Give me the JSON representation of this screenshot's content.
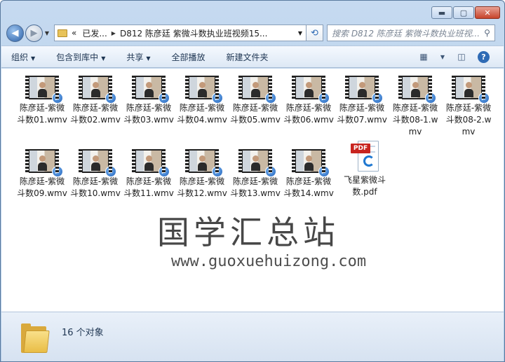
{
  "window": {
    "caption": {
      "minimize": "▬",
      "maximize": "▢",
      "close": "✕"
    }
  },
  "nav": {
    "back_icon": "arrow-left-icon",
    "forward_icon": "arrow-right-icon",
    "breadcrumb_prefix": "«",
    "breadcrumb_1": "已发...",
    "breadcrumb_2": "D812 陈彦廷 紫微斗数执业班视频15...",
    "search_placeholder": "搜索 D812 陈彦廷 紫微斗数执业班视..."
  },
  "toolbar": {
    "organize": "组织",
    "include_library": "包含到库中",
    "share": "共享",
    "play_all": "全部播放",
    "new_folder": "新建文件夹"
  },
  "files": [
    {
      "name": "陈彦廷-紫微斗数01.wmv",
      "type": "video"
    },
    {
      "name": "陈彦廷-紫微斗数02.wmv",
      "type": "video"
    },
    {
      "name": "陈彦廷-紫微斗数03.wmv",
      "type": "video"
    },
    {
      "name": "陈彦廷-紫微斗数04.wmv",
      "type": "video"
    },
    {
      "name": "陈彦廷-紫微斗数05.wmv",
      "type": "video"
    },
    {
      "name": "陈彦廷-紫微斗数06.wmv",
      "type": "video"
    },
    {
      "name": "陈彦廷-紫微斗数07.wmv",
      "type": "video"
    },
    {
      "name": "陈彦廷-紫微斗数08-1.wmv",
      "type": "video"
    },
    {
      "name": "陈彦廷-紫微斗数08-2.wmv",
      "type": "video"
    },
    {
      "name": "陈彦廷-紫微斗数09.wmv",
      "type": "video"
    },
    {
      "name": "陈彦廷-紫微斗数10.wmv",
      "type": "video"
    },
    {
      "name": "陈彦廷-紫微斗数11.wmv",
      "type": "video"
    },
    {
      "name": "陈彦廷-紫微斗数12.wmv",
      "type": "video"
    },
    {
      "name": "陈彦廷-紫微斗数13.wmv",
      "type": "video"
    },
    {
      "name": "陈彦廷-紫微斗数14.wmv",
      "type": "video"
    },
    {
      "name": "飞星紫微斗数.pdf",
      "type": "pdf",
      "badge": "PDF"
    }
  ],
  "watermark": {
    "chinese": "国学汇总站",
    "url": "www.guoxuehuizong.com"
  },
  "status": {
    "count": "16 个对象"
  }
}
